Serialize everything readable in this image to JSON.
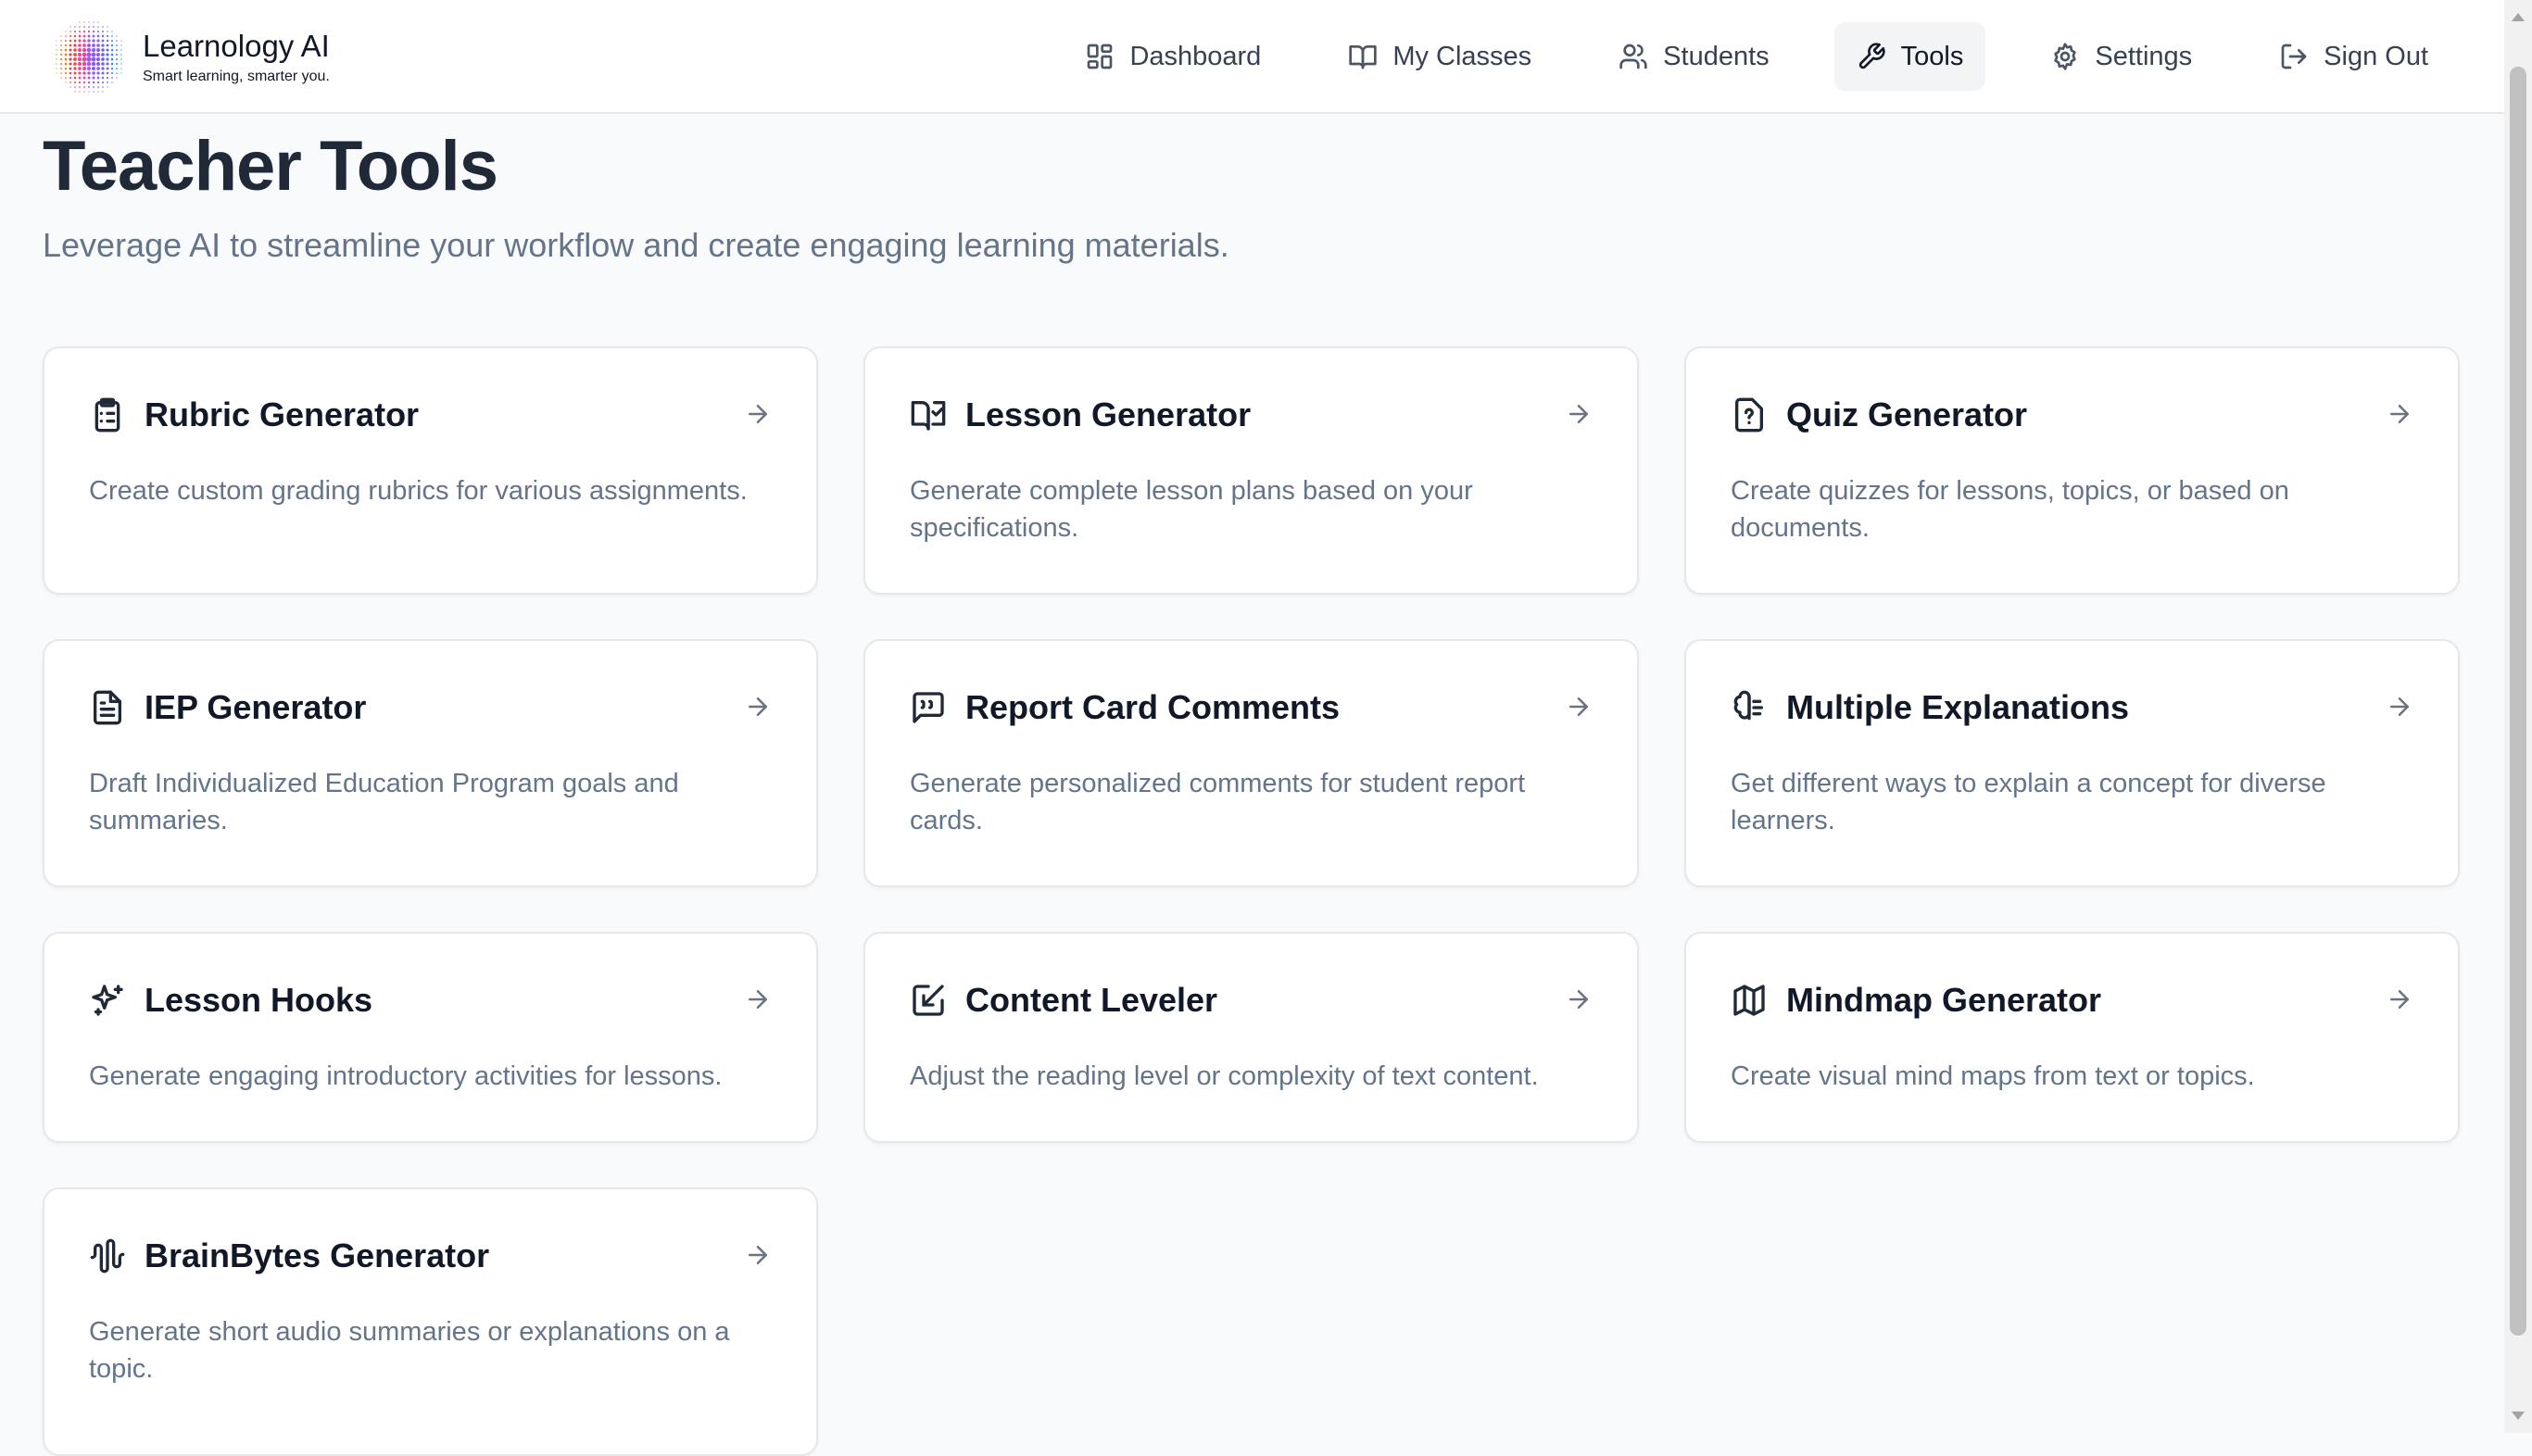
{
  "brand": {
    "name": "Learnology AI",
    "tagline": "Smart learning, smarter you."
  },
  "nav": [
    {
      "label": "Dashboard",
      "icon": "dashboard-icon",
      "active": false
    },
    {
      "label": "My Classes",
      "icon": "book-open-icon",
      "active": false
    },
    {
      "label": "Students",
      "icon": "users-icon",
      "active": false
    },
    {
      "label": "Tools",
      "icon": "wrench-icon",
      "active": true
    },
    {
      "label": "Settings",
      "icon": "gear-icon",
      "active": false
    },
    {
      "label": "Sign Out",
      "icon": "sign-out-icon",
      "active": false
    }
  ],
  "page": {
    "title": "Teacher Tools",
    "subtitle": "Leverage AI to streamline your workflow and create engaging learning materials."
  },
  "tools": [
    {
      "title": "Rubric Generator",
      "description": "Create custom grading rubrics for various assignments.",
      "icon": "clipboard-list-icon"
    },
    {
      "title": "Lesson Generator",
      "description": "Generate complete lesson plans based on your specifications.",
      "icon": "book-check-icon"
    },
    {
      "title": "Quiz Generator",
      "description": "Create quizzes for lessons, topics, or based on documents.",
      "icon": "file-question-icon"
    },
    {
      "title": "IEP Generator",
      "description": "Draft Individualized Education Program goals and summaries.",
      "icon": "file-text-icon"
    },
    {
      "title": "Report Card Comments",
      "description": "Generate personalized comments for student report cards.",
      "icon": "message-quote-icon"
    },
    {
      "title": "Multiple Explanations",
      "description": "Get different ways to explain a concept for diverse learners.",
      "icon": "brain-icon"
    },
    {
      "title": "Lesson Hooks",
      "description": "Generate engaging introductory activities for lessons.",
      "icon": "sparkles-icon"
    },
    {
      "title": "Content Leveler",
      "description": "Adjust the reading level or complexity of text content.",
      "icon": "square-arrow-icon"
    },
    {
      "title": "Mindmap Generator",
      "description": "Create visual mind maps from text or topics.",
      "icon": "map-icon"
    },
    {
      "title": "BrainBytes Generator",
      "description": "Generate short audio summaries or explanations on a topic.",
      "icon": "audio-wave-icon"
    }
  ]
}
